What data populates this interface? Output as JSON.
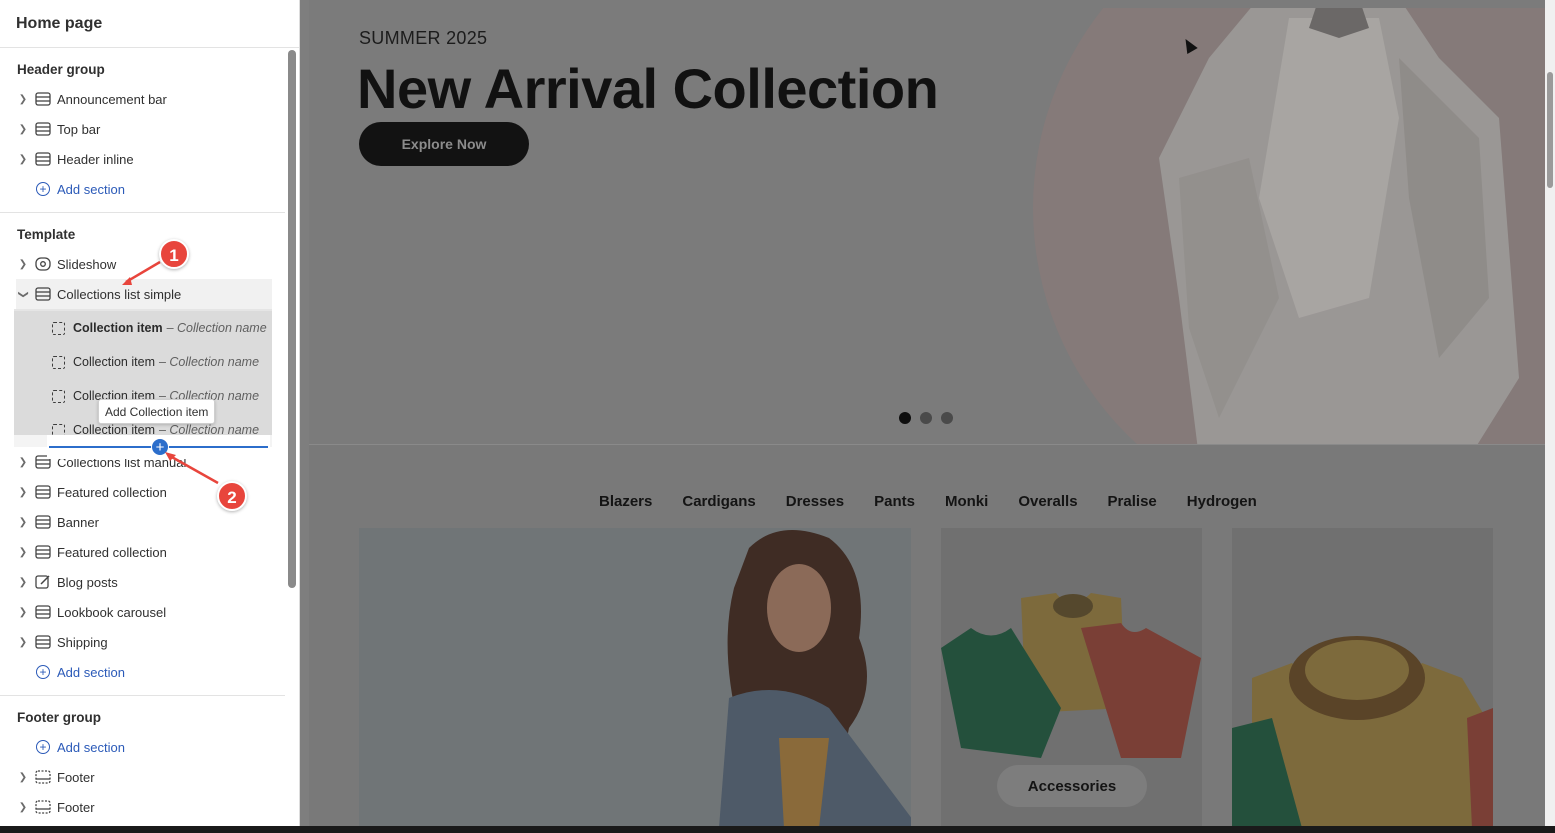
{
  "sidebar": {
    "title": "Home page",
    "header_group": {
      "title": "Header group",
      "items": [
        {
          "label": "Announcement bar"
        },
        {
          "label": "Top bar"
        },
        {
          "label": "Header inline"
        }
      ],
      "add_label": "Add section"
    },
    "template": {
      "title": "Template",
      "items": [
        {
          "label": "Slideshow"
        },
        {
          "label": "Collections list simple"
        },
        {
          "label": "Collections list manual"
        },
        {
          "label": "Featured collection"
        },
        {
          "label": "Banner"
        },
        {
          "label": "Featured collection"
        },
        {
          "label": "Blog posts"
        },
        {
          "label": "Lookbook carousel"
        },
        {
          "label": "Shipping"
        }
      ],
      "sub_items": [
        {
          "label": "Collection item",
          "detail": "– Collection name"
        },
        {
          "label": "Collection item",
          "detail": "– Collection name"
        },
        {
          "label": "Collection item",
          "detail": "– Collection name"
        },
        {
          "label": "Collection item",
          "detail": "– Collection name"
        }
      ],
      "add_label": "Add section"
    },
    "footer_group": {
      "title": "Footer group",
      "add_label": "Add section",
      "items": [
        {
          "label": "Footer"
        },
        {
          "label": "Footer"
        }
      ]
    },
    "tooltip": "Add Collection item"
  },
  "annotations": {
    "badge1": "1",
    "badge2": "2"
  },
  "preview": {
    "hero": {
      "subtitle": "SUMMER 2025",
      "title": "New Arrival Collection",
      "button": "Explore Now",
      "slides": 3,
      "active_slide": 1
    },
    "categories": [
      "Blazers",
      "Cardigans",
      "Dresses",
      "Pants",
      "Monki",
      "Overalls",
      "Pralise",
      "Hydrogen"
    ],
    "card_label": "Accessories"
  },
  "colors": {
    "accent": "#2c6ecb",
    "badge": "#e8453c",
    "link": "#2b5ab8"
  }
}
